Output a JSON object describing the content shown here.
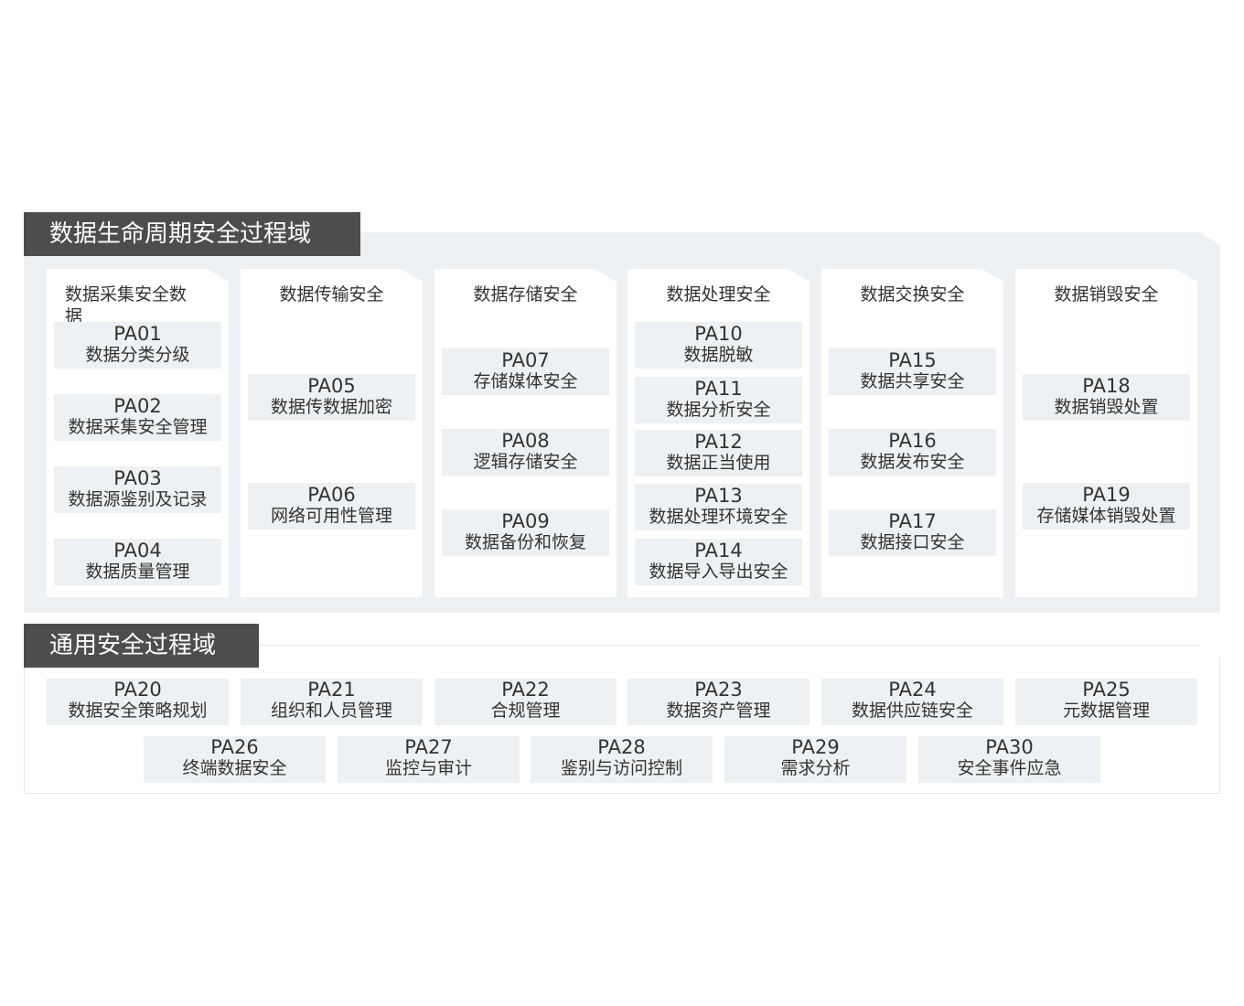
{
  "lifecycle": {
    "title": "数据生命周期安全过程域",
    "columns": [
      {
        "head": "数据采集安全数据",
        "items": [
          {
            "code": "PA01",
            "name": "数据分类分级"
          },
          {
            "code": "PA02",
            "name": "数据采集安全管理"
          },
          {
            "code": "PA03",
            "name": "数据源鉴别及记录"
          },
          {
            "code": "PA04",
            "name": "数据质量管理"
          }
        ]
      },
      {
        "head": "数据传输安全",
        "items": [
          {
            "code": "PA05",
            "name": "数据传数据加密"
          },
          {
            "code": "PA06",
            "name": "网络可用性管理"
          }
        ]
      },
      {
        "head": "数据存储安全",
        "items": [
          {
            "code": "PA07",
            "name": "存储媒体安全"
          },
          {
            "code": "PA08",
            "name": "逻辑存储安全"
          },
          {
            "code": "PA09",
            "name": "数据备份和恢复"
          }
        ]
      },
      {
        "head": "数据处理安全",
        "items": [
          {
            "code": "PA10",
            "name": "数据脱敏"
          },
          {
            "code": "PA11",
            "name": "数据分析安全"
          },
          {
            "code": "PA12",
            "name": "数据正当使用"
          },
          {
            "code": "PA13",
            "name": "数据处理环境安全"
          },
          {
            "code": "PA14",
            "name": "数据导入导出安全"
          }
        ]
      },
      {
        "head": "数据交换安全",
        "items": [
          {
            "code": "PA15",
            "name": "数据共享安全"
          },
          {
            "code": "PA16",
            "name": "数据发布安全"
          },
          {
            "code": "PA17",
            "name": "数据接口安全"
          }
        ]
      },
      {
        "head": "数据销毁安全",
        "items": [
          {
            "code": "PA18",
            "name": "数据销毁处置"
          },
          {
            "code": "PA19",
            "name": "存储媒体销毁处置"
          }
        ]
      }
    ]
  },
  "general": {
    "title": "通用安全过程域",
    "items": [
      {
        "code": "PA20",
        "name": "数据安全策略规划"
      },
      {
        "code": "PA21",
        "name": "组织和人员管理"
      },
      {
        "code": "PA22",
        "name": "合规管理"
      },
      {
        "code": "PA23",
        "name": "数据资产管理"
      },
      {
        "code": "PA24",
        "name": "数据供应链安全"
      },
      {
        "code": "PA25",
        "name": "元数据管理"
      },
      {
        "code": "PA26",
        "name": "终端数据安全"
      },
      {
        "code": "PA27",
        "name": "监控与审计"
      },
      {
        "code": "PA28",
        "name": "鉴别与访问控制"
      },
      {
        "code": "PA29",
        "name": "需求分析"
      },
      {
        "code": "PA30",
        "name": "安全事件应急"
      }
    ]
  }
}
